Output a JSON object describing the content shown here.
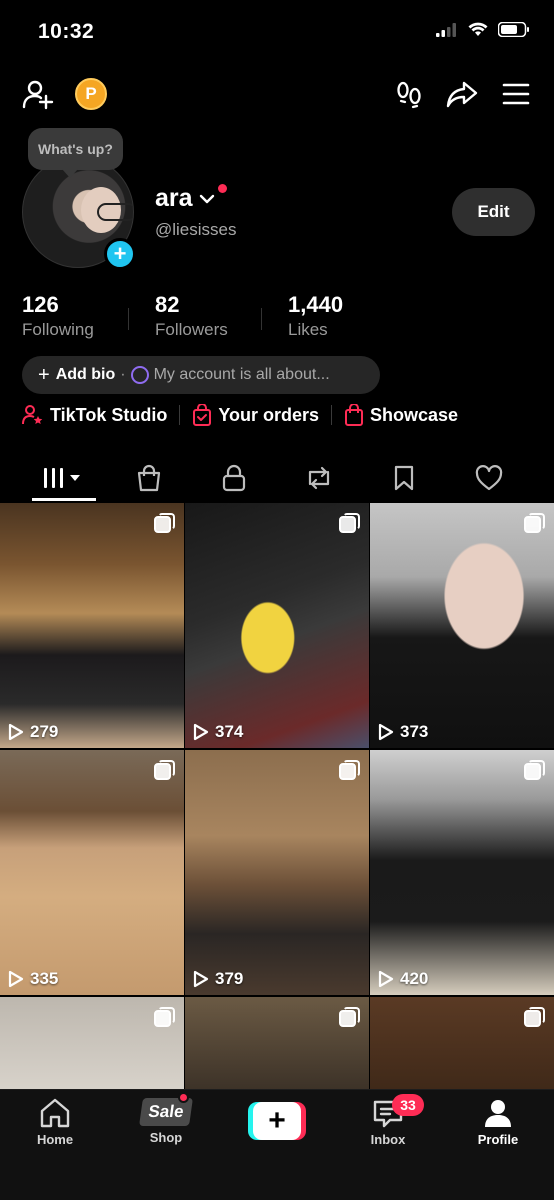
{
  "status_bar": {
    "time": "10:32"
  },
  "profile": {
    "status_bubble": "What's up?",
    "name": "ara",
    "handle": "@liesisses",
    "edit_label": "Edit"
  },
  "stats": [
    {
      "value": "126",
      "label": "Following"
    },
    {
      "value": "82",
      "label": "Followers"
    },
    {
      "value": "1,440",
      "label": "Likes"
    }
  ],
  "bio": {
    "add_label": "Add bio",
    "separator": "·",
    "placeholder": "My account is all about..."
  },
  "links": [
    {
      "label": "TikTok Studio",
      "icon": "person-star-icon"
    },
    {
      "label": "Your orders",
      "icon": "shopping-bag-check-icon"
    },
    {
      "label": "Showcase",
      "icon": "shopping-bag-icon"
    }
  ],
  "tabs": [
    {
      "icon": "grid-icon",
      "active": true
    },
    {
      "icon": "shop-bag-icon"
    },
    {
      "icon": "lock-icon"
    },
    {
      "icon": "repost-icon"
    },
    {
      "icon": "bookmark-icon"
    },
    {
      "icon": "heart-icon"
    }
  ],
  "videos": [
    {
      "views": "279",
      "multi": true
    },
    {
      "views": "374",
      "multi": true
    },
    {
      "views": "373",
      "multi": true
    },
    {
      "views": "335",
      "multi": true
    },
    {
      "views": "379",
      "multi": true
    },
    {
      "views": "420",
      "multi": true
    },
    {
      "views": "",
      "multi": true
    },
    {
      "views": "",
      "multi": true
    },
    {
      "views": "",
      "multi": true
    }
  ],
  "bottom_nav": {
    "home": "Home",
    "shop": "Shop",
    "shop_badge": "Sale",
    "inbox": "Inbox",
    "inbox_badge": "33",
    "profile": "Profile"
  },
  "colors": {
    "accent_red": "#fe2c55",
    "accent_cyan": "#25f4ee",
    "avatar_add": "#20c5f0",
    "coin": "#f5a623"
  }
}
